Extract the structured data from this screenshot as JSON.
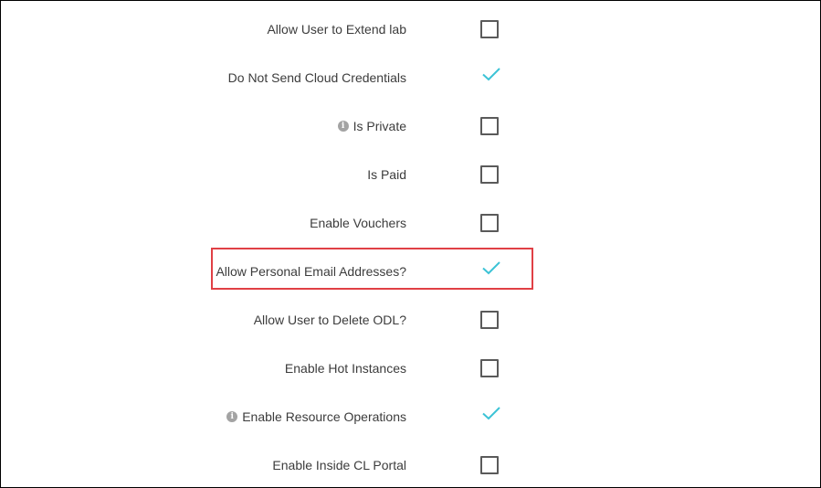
{
  "settings": [
    {
      "label": "Allow User to Extend lab",
      "checked": false,
      "info": false
    },
    {
      "label": "Do Not Send Cloud Credentials",
      "checked": true,
      "info": false
    },
    {
      "label": "Is Private",
      "checked": false,
      "info": true
    },
    {
      "label": "Is Paid",
      "checked": false,
      "info": false
    },
    {
      "label": "Enable Vouchers",
      "checked": false,
      "info": false
    },
    {
      "label": "Allow Personal Email Addresses?",
      "checked": true,
      "info": false,
      "highlighted": true
    },
    {
      "label": "Allow User to Delete ODL?",
      "checked": false,
      "info": false
    },
    {
      "label": "Enable Hot Instances",
      "checked": false,
      "info": false
    },
    {
      "label": "Enable Resource Operations",
      "checked": true,
      "info": true
    },
    {
      "label": "Enable Inside CL Portal",
      "checked": false,
      "info": false
    }
  ],
  "info_icon_glyph": "i",
  "colors": {
    "check": "#3cc3d6",
    "checkbox_border": "#5a5a5a",
    "highlight_border": "#e04045",
    "label_text": "#3c3c3c",
    "info_icon": "#a3a3a3"
  }
}
